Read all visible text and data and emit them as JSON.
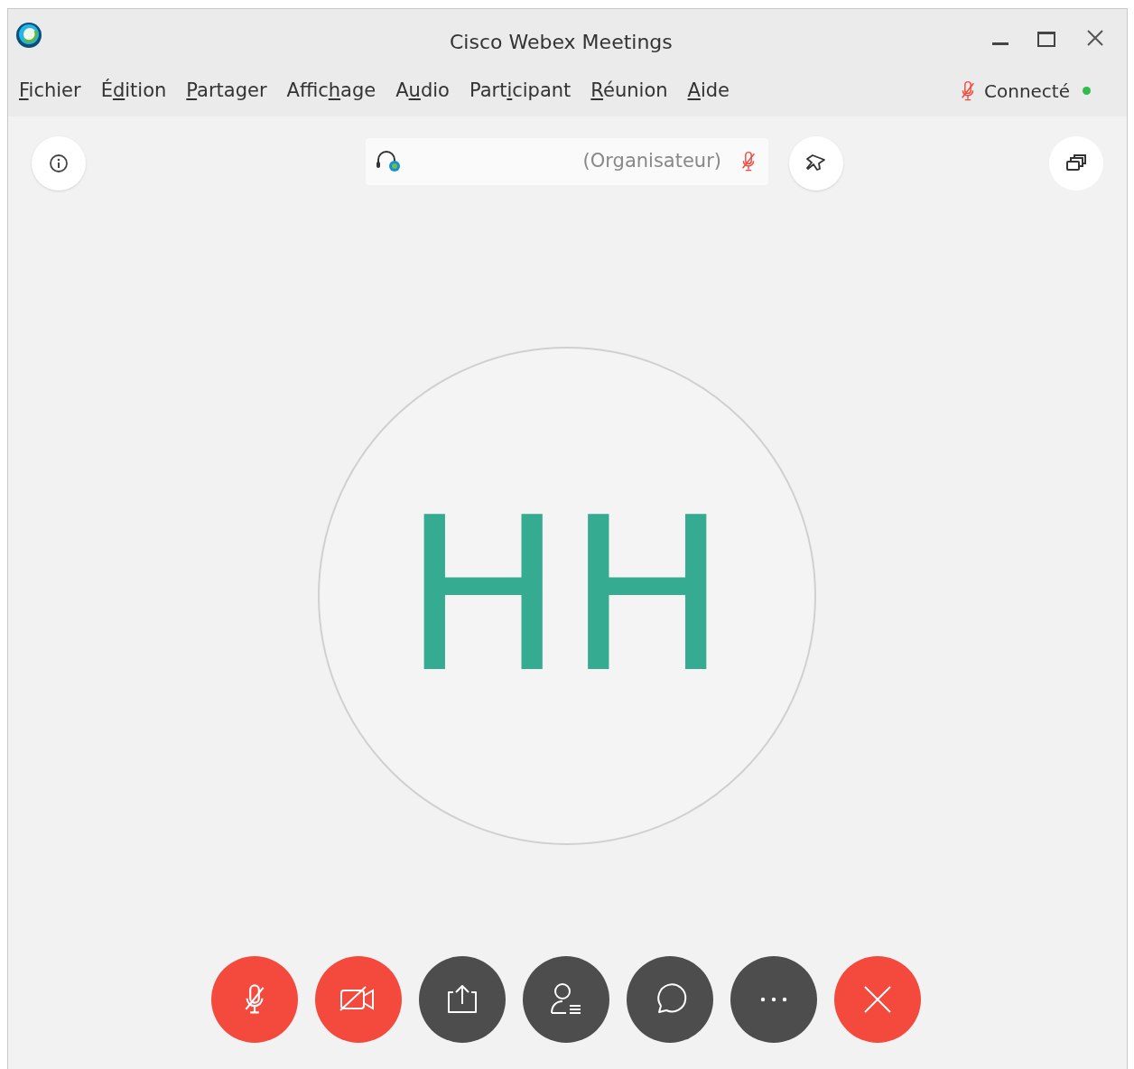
{
  "window": {
    "title": "Cisco Webex Meetings"
  },
  "menu": [
    {
      "key": "F",
      "after": "ichier"
    },
    {
      "before": "É",
      "key": "d",
      "after": "ition"
    },
    {
      "key": "P",
      "after": "artager"
    },
    {
      "before": "Affic",
      "key": "h",
      "after": "age"
    },
    {
      "before": "A",
      "key": "u",
      "after": "dio"
    },
    {
      "before": "Part",
      "key": "i",
      "after": "cipant"
    },
    {
      "key": "R",
      "after": "éunion"
    },
    {
      "key": "A",
      "after": "ide"
    }
  ],
  "status": {
    "label": "Connecté",
    "muted": true,
    "connected": true
  },
  "speaker": {
    "role": "(Organisateur)",
    "muted": true
  },
  "avatar": {
    "initials": "HH"
  },
  "controls": [
    {
      "kind": "mute"
    },
    {
      "kind": "video"
    },
    {
      "kind": "share"
    },
    {
      "kind": "participants"
    },
    {
      "kind": "chat"
    },
    {
      "kind": "more"
    },
    {
      "kind": "leave"
    }
  ]
}
